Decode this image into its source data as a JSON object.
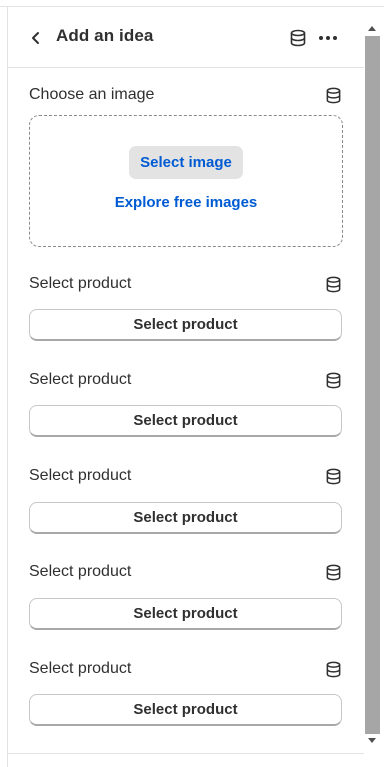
{
  "header": {
    "title": "Add an idea",
    "back_icon": "chevron-left-icon",
    "database_icon": "database-icon",
    "more_icon": "more-horizontal-icon"
  },
  "image_section": {
    "label": "Choose an image",
    "select_button": "Select image",
    "explore_link": "Explore free images"
  },
  "product_sections": [
    {
      "label": "Select product",
      "button": "Select product"
    },
    {
      "label": "Select product",
      "button": "Select product"
    },
    {
      "label": "Select product",
      "button": "Select product"
    },
    {
      "label": "Select product",
      "button": "Select product"
    },
    {
      "label": "Select product",
      "button": "Select product"
    }
  ],
  "colors": {
    "link": "#005bd3",
    "text": "#303030",
    "border": "#e3e3e3"
  }
}
